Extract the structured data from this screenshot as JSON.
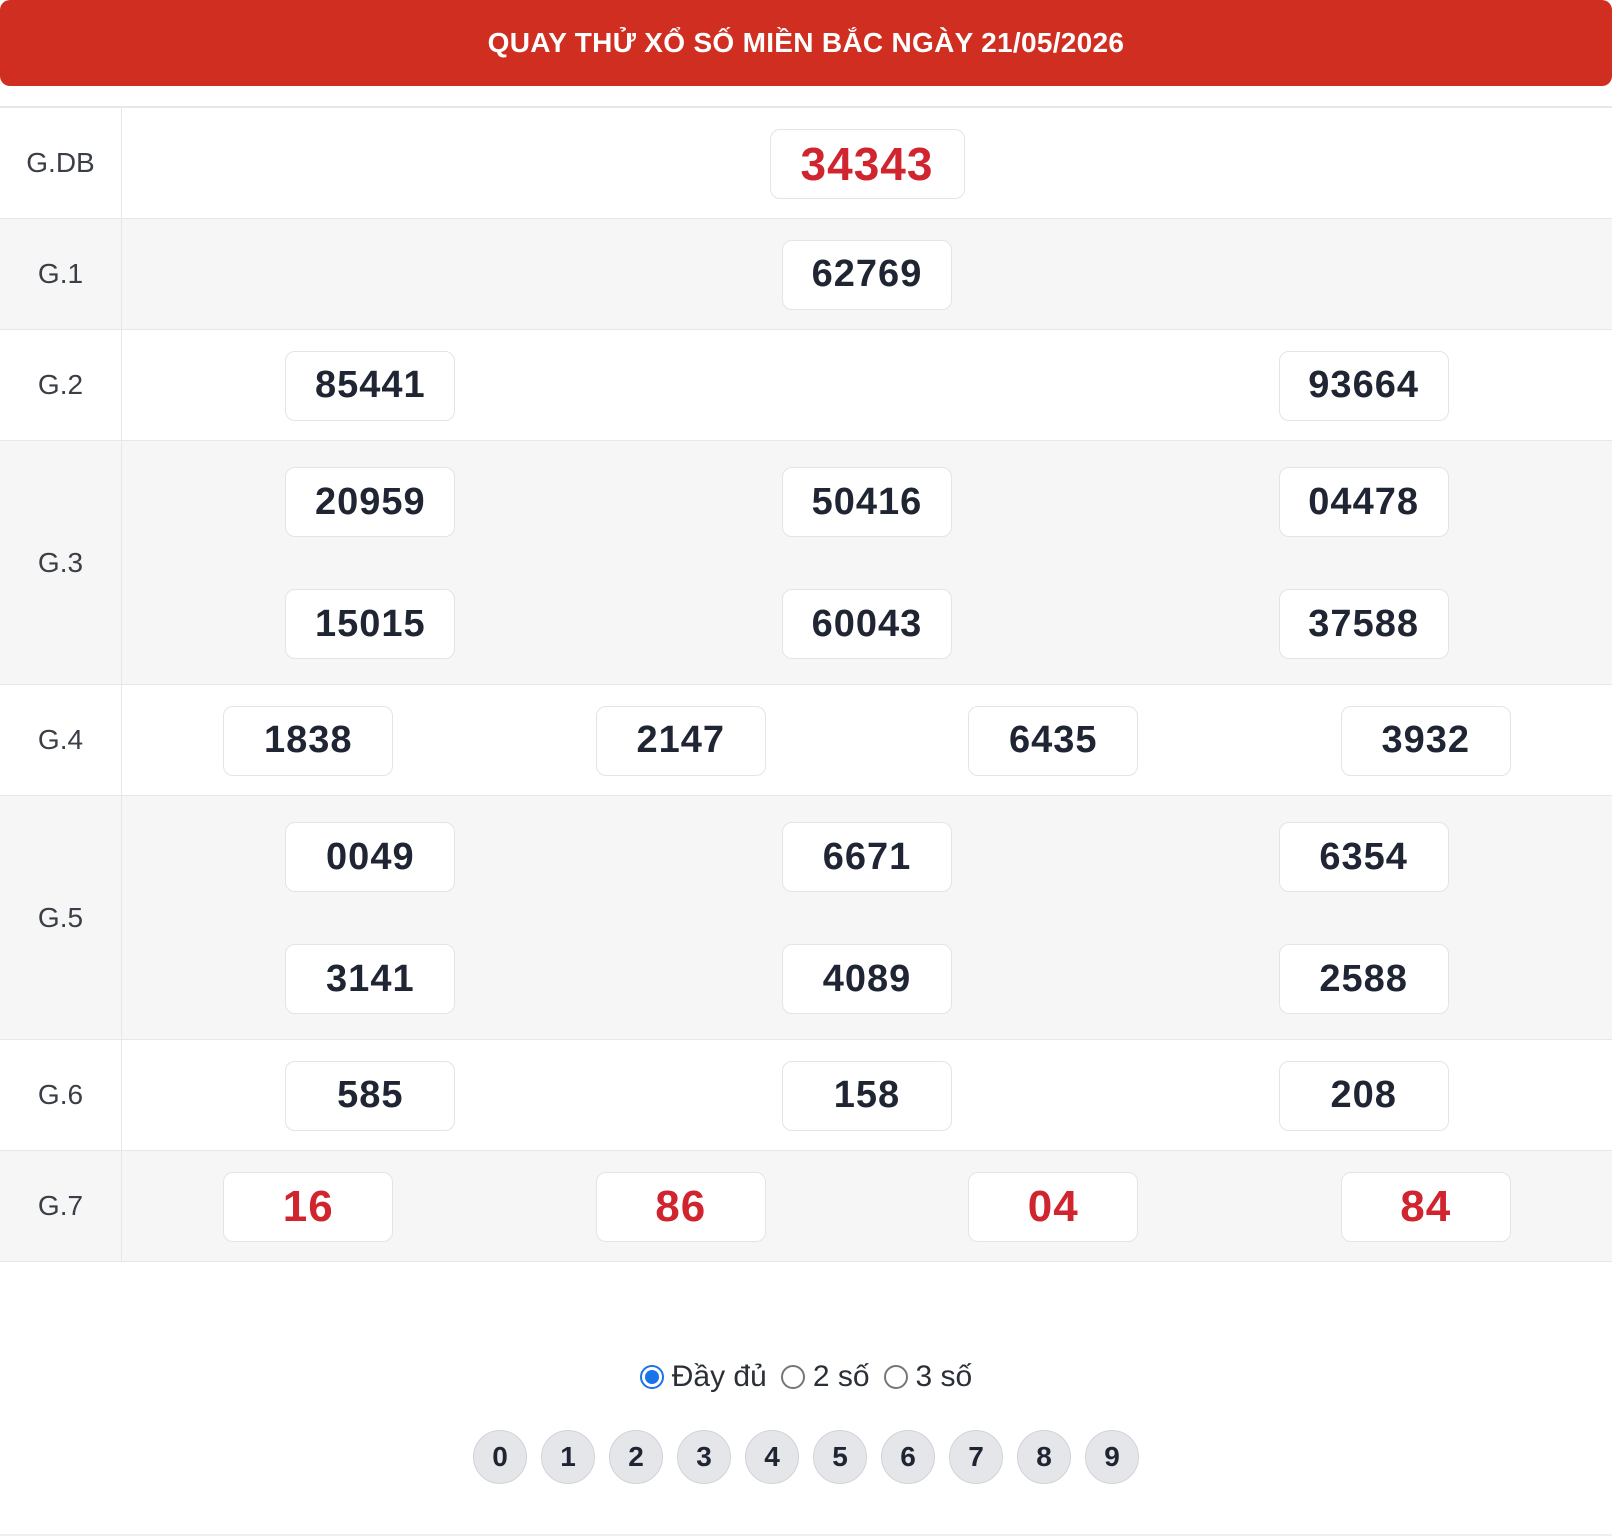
{
  "header": {
    "title": "QUAY THỬ XỔ SỐ MIỀN BẮC NGÀY 21/05/2026"
  },
  "prizes": [
    {
      "label": "G.DB",
      "values": [
        "34343"
      ]
    },
    {
      "label": "G.1",
      "values": [
        "62769"
      ]
    },
    {
      "label": "G.2",
      "values": [
        "85441",
        "93664"
      ]
    },
    {
      "label": "G.3",
      "values": [
        "20959",
        "50416",
        "04478",
        "15015",
        "60043",
        "37588"
      ]
    },
    {
      "label": "G.4",
      "values": [
        "1838",
        "2147",
        "6435",
        "3932"
      ]
    },
    {
      "label": "G.5",
      "values": [
        "0049",
        "6671",
        "6354",
        "3141",
        "4089",
        "2588"
      ]
    },
    {
      "label": "G.6",
      "values": [
        "585",
        "158",
        "208"
      ]
    },
    {
      "label": "G.7",
      "values": [
        "16",
        "86",
        "04",
        "84"
      ]
    }
  ],
  "filters": {
    "options": [
      "Đầy đủ",
      "2 số",
      "3 số"
    ],
    "selected": "Đầy đủ"
  },
  "digits": [
    "0",
    "1",
    "2",
    "3",
    "4",
    "5",
    "6",
    "7",
    "8",
    "9"
  ],
  "colors": {
    "header_bg": "#d02e20",
    "highlight_red": "#d0242f",
    "radio_accent": "#1a73e8"
  }
}
